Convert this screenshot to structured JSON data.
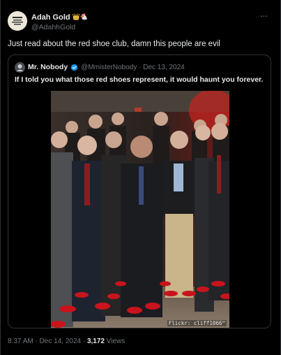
{
  "post": {
    "author": {
      "display_name": "Adah Gold",
      "badges": "👑🐔",
      "handle": "@AdahhGold",
      "avatar_icon": "avatar-image"
    },
    "more_icon": "ellipsis-icon",
    "text": "Just read about the red shoe club, damn this people are evil",
    "timestamp": "8:37 AM · Dec 14, 2024 · ",
    "views_count": "3,172",
    "views_label": " Views"
  },
  "quote": {
    "author": {
      "display_name": "Mr. Nobody",
      "verified_icon": "verified-badge-icon",
      "handle_date": "@MmisterNobody · Dec 13, 2024"
    },
    "text": "If I told you what those red shoes represent, it would haunt you forever.",
    "image": {
      "description_icon": "group-photo-red-shoes",
      "watermark": "Flickr: cliff1066™"
    }
  },
  "colors": {
    "background": "#000000",
    "text_primary": "#e7e9ea",
    "text_secondary": "#71767b",
    "border": "#2f3336",
    "verified": "#1d9bf0",
    "shoe_red": "#c8141c"
  }
}
